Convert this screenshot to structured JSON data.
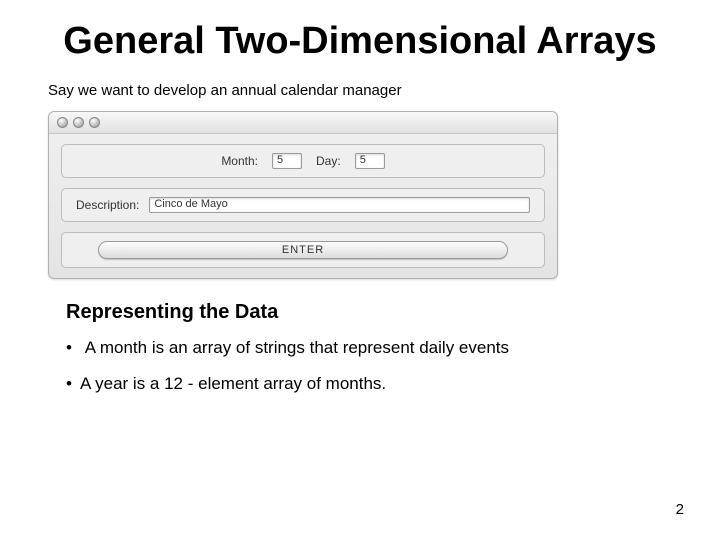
{
  "title": "General Two-Dimensional Arrays",
  "intro": "Say we want to develop an annual calendar manager",
  "window": {
    "month_label": "Month:",
    "month_value": "5",
    "day_label": "Day:",
    "day_value": "5",
    "description_label": "Description:",
    "description_value": "Cinco de Mayo",
    "enter_button": "ENTER"
  },
  "subhead": "Representing the Data",
  "bullets": [
    "A month is an array of strings that represent daily events",
    "A year is a 12 - element array of months."
  ],
  "page_number": "2"
}
